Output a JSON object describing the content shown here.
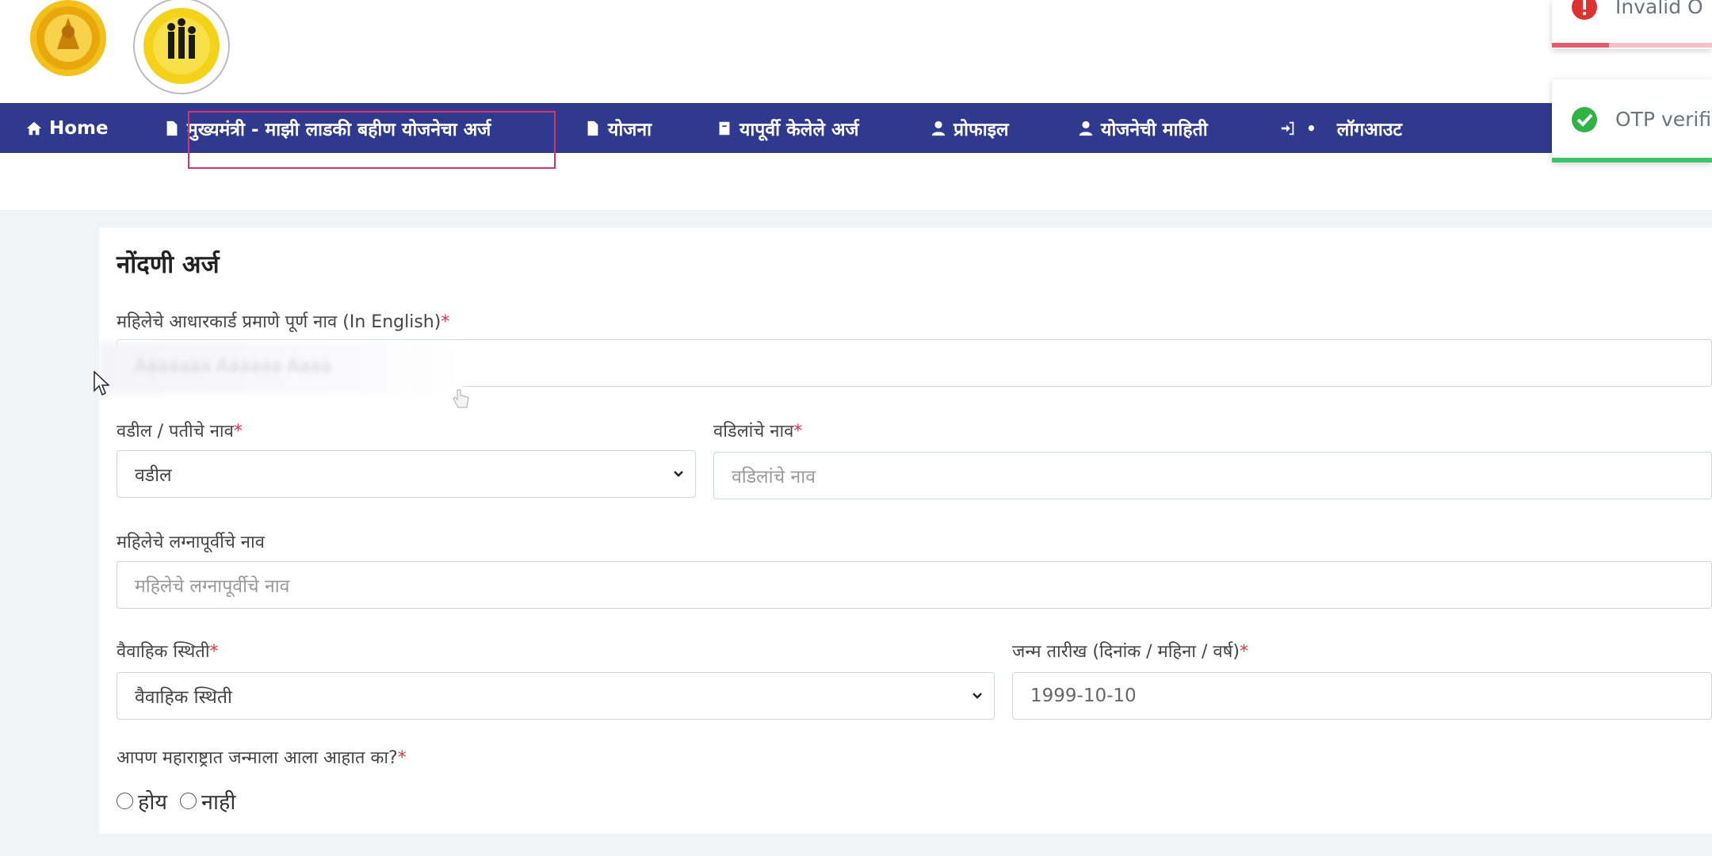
{
  "nav": {
    "home": "Home",
    "apply": "मुख्यमंत्री - माझी लाडकी बहीण योजनेचा अर्ज",
    "yojana": "योजना",
    "previous_applications": "यापूर्वी केलेले अर्ज",
    "profile": "प्रोफाइल",
    "scheme_info": "योजनेची माहिती",
    "logout_dot": "•",
    "logout": "लॉगआउट"
  },
  "toasts": {
    "error": "Invalid O",
    "success": "OTP verifi"
  },
  "form": {
    "title": "नोंदणी अर्ज",
    "full_name_label": "महिलेचे आधारकार्ड प्रमाणे पूर्ण नाव (In English)",
    "full_name_value": "Aaaaaaa Aaaaaa Aaaa",
    "father_husband_label": "वडील / पतीचे नाव",
    "father_husband_selected": "वडील",
    "father_name_label": "वडिलांचे नाव",
    "father_name_placeholder": "वडिलांचे नाव",
    "maiden_name_label": "महिलेचे लग्नापूर्वीचे नाव",
    "maiden_name_placeholder": "महिलेचे लग्नापूर्वीचे नाव",
    "marital_label": "वैवाहिक स्थिती",
    "marital_selected": "वैवाहिक स्थिती",
    "dob_label": "जन्म तारीख (दिनांक / महिना / वर्ष)",
    "dob_value": "1999-10-10",
    "born_mh_label": "आपण महाराष्ट्रात जन्माला आला आहात का?",
    "option_yes": "होय",
    "option_no": "नाही",
    "required_mark": "*"
  },
  "colors": {
    "navbar": "#2f3a8f",
    "highlight": "#d6336c",
    "required": "#dc3545",
    "success": "#3ec46d",
    "error": "#e35d6a"
  }
}
